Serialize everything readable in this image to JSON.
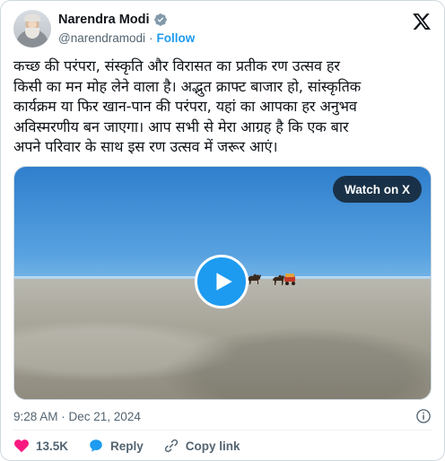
{
  "author": {
    "name": "Narendra Modi",
    "handle": "@narendramodi",
    "separator": "·",
    "follow_label": "Follow",
    "verified_color": "#829aab",
    "avatar_icon": "profile-photo"
  },
  "tweet": {
    "lines": [
      "कच्छ की परंपरा, संस्कृति और विरासत का प्रतीक रण उत्सव हर",
      "किसी का मन मोह लेने वाला है। अद्भुत क्राफ्ट बाजार हो, सांस्कृतिक",
      "कार्यक्रम या फिर खान-पान की परंपरा, यहां का आपका हर अनुभव",
      "अविस्मरणीय बन जाएगा। आप सभी से मेरा आग्रह है कि एक बार",
      "अपने परिवार के साथ इस रण उत्सव में जरूर आएं।"
    ]
  },
  "media": {
    "watch_label": "Watch on X",
    "play_icon": "play-icon",
    "accent": "#1d9bf0"
  },
  "meta": {
    "timestamp": "9:28 AM · Dec 21, 2024"
  },
  "actions": {
    "likes": "13.5K",
    "reply_label": "Reply",
    "copy_link_label": "Copy link",
    "like_color": "#f91880",
    "reply_color": "#1d9bf0"
  }
}
